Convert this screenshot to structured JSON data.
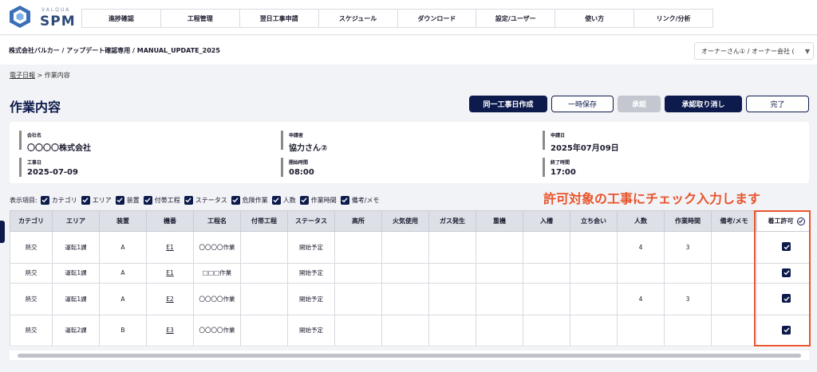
{
  "logo": {
    "sub": "VALQUA",
    "main": "SPM"
  },
  "nav": [
    "進捗確認",
    "工程管理",
    "翌日工事申請",
    "スケジュール",
    "ダウンロード",
    "設定/ユーザー",
    "使い方",
    "リンク/分析"
  ],
  "path": "株式会社バルカー / アップデート確認専用 / MANUAL_UPDATE_2025",
  "owner_select": "オーナーさん① / オーナー会社 (",
  "breadcrumb": {
    "link": "電子日報",
    "sep": " > ",
    "current": "作業内容"
  },
  "page_title": "作業内容",
  "buttons": {
    "same_day": "同一工事日作成",
    "temp_save": "一時保存",
    "approve": "承認",
    "cancel_approve": "承認取り消し",
    "done": "完了"
  },
  "info": {
    "company_label": "会社名",
    "company": "〇〇〇〇株式会社",
    "applicant_label": "申請者",
    "applicant": "協力さん②",
    "apply_date_label": "申請日",
    "apply_date": "2025年07月09日",
    "work_date_label": "工事日",
    "work_date": "2025-07-09",
    "start_label": "開始時間",
    "start": "08:00",
    "end_label": "終了時間",
    "end": "17:00"
  },
  "display": {
    "label": "表示項目:",
    "items": [
      "カテゴリ",
      "エリア",
      "装置",
      "付帯工程",
      "ステータス",
      "危険作業",
      "人数",
      "作業時間",
      "備考/メモ"
    ]
  },
  "annotation": "許可対象の工事にチェック入力します",
  "table": {
    "headers": [
      "カテゴリ",
      "エリア",
      "装置",
      "機番",
      "工程名",
      "付帯工程",
      "ステータス",
      "高所",
      "火気使用",
      "ガス発生",
      "重機",
      "入槽",
      "立ち会い",
      "人数",
      "作業時間",
      "備考/メモ",
      "着工許可"
    ],
    "rows": [
      {
        "category": "熱交",
        "area": "運転1課",
        "device": "A",
        "machine": "E1",
        "process": "〇〇〇〇作業",
        "status": "開始予定",
        "people": "4",
        "hours": "3"
      },
      {
        "category": "熱交",
        "area": "運転1課",
        "device": "A",
        "machine": "E1",
        "process": "□□□作業",
        "status": "開始予定",
        "people": "",
        "hours": ""
      },
      {
        "category": "熱交",
        "area": "運転1課",
        "device": "A",
        "machine": "E2",
        "process": "〇〇〇〇作業",
        "status": "開始予定",
        "people": "4",
        "hours": "3"
      },
      {
        "category": "熱交",
        "area": "運転2課",
        "device": "B",
        "machine": "E3",
        "process": "〇〇〇〇作業",
        "status": "開始予定",
        "people": "",
        "hours": ""
      }
    ]
  },
  "colors": {
    "primary": "#0d1b4c",
    "accent": "#e8542c",
    "disabled": "#c4c7cf"
  }
}
